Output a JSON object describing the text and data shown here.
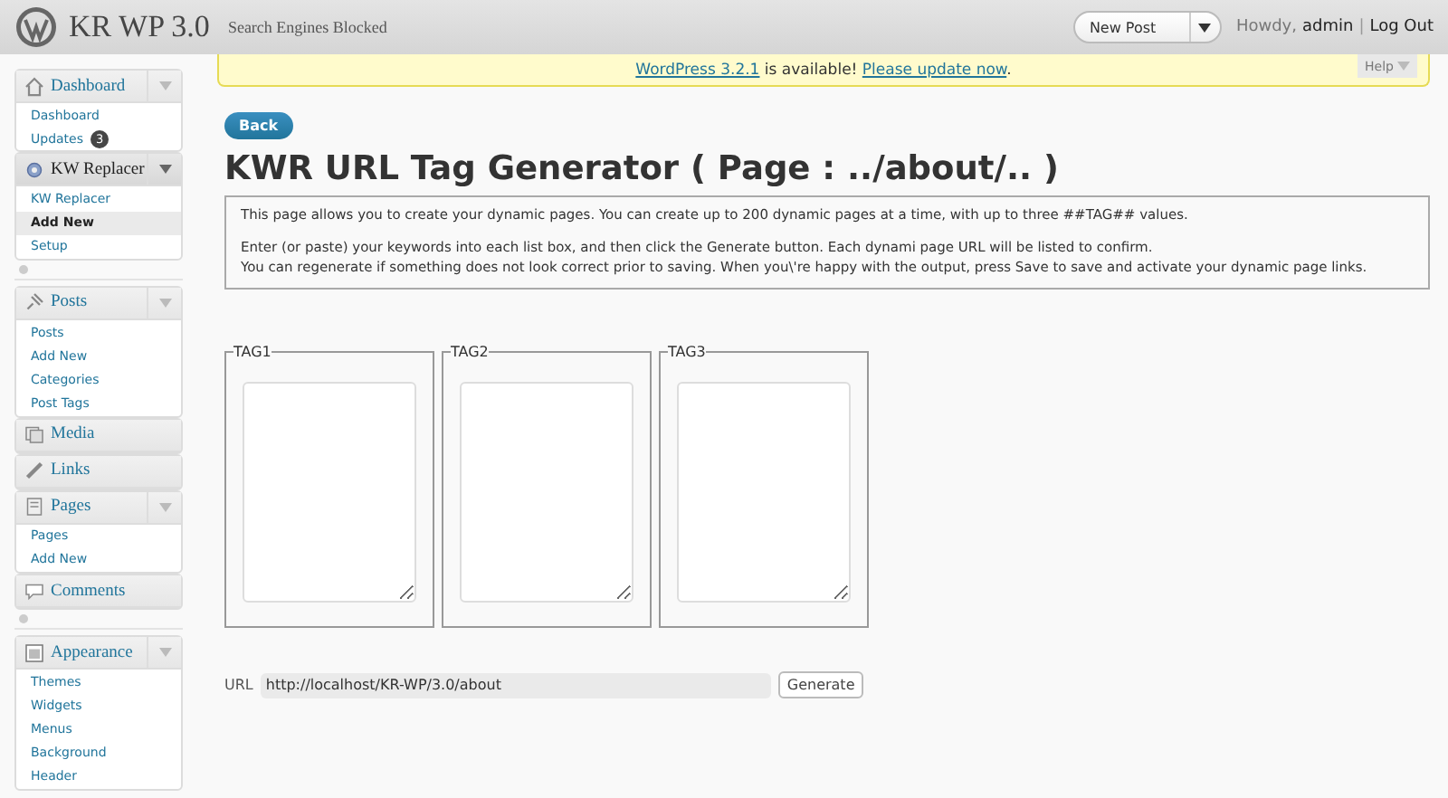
{
  "header": {
    "site_title": "KR WP 3.0",
    "site_note": "Search Engines Blocked",
    "new_post": "New Post",
    "howdy": "Howdy, ",
    "user": "admin",
    "separator": "|",
    "logout": "Log Out"
  },
  "notice": {
    "link1": "WordPress 3.2.1",
    "text": " is available! ",
    "link2": "Please update now",
    "end": ".",
    "help": "Help"
  },
  "menu": [
    {
      "kind": "group",
      "label": "Dashboard",
      "toggle": true,
      "current": false,
      "items": [
        {
          "label": "Dashboard",
          "selected": false
        },
        {
          "label": "Updates",
          "badge": "3",
          "selected": false
        }
      ]
    },
    {
      "kind": "group",
      "label": "KW Replacer",
      "toggle": true,
      "current": true,
      "items": [
        {
          "label": "KW Replacer",
          "selected": false
        },
        {
          "label": "Add New",
          "selected": true
        },
        {
          "label": "Setup",
          "selected": false
        }
      ]
    },
    {
      "kind": "separator"
    },
    {
      "kind": "group",
      "label": "Posts",
      "toggle": true,
      "current": false,
      "items": [
        {
          "label": "Posts",
          "selected": false
        },
        {
          "label": "Add New",
          "selected": false
        },
        {
          "label": "Categories",
          "selected": false
        },
        {
          "label": "Post Tags",
          "selected": false
        }
      ]
    },
    {
      "kind": "group",
      "label": "Media",
      "toggle": false,
      "current": false
    },
    {
      "kind": "group",
      "label": "Links",
      "toggle": false,
      "current": false
    },
    {
      "kind": "group",
      "label": "Pages",
      "toggle": true,
      "current": false,
      "items": [
        {
          "label": "Pages",
          "selected": false
        },
        {
          "label": "Add New",
          "selected": false
        }
      ]
    },
    {
      "kind": "group",
      "label": "Comments",
      "toggle": false,
      "current": false
    },
    {
      "kind": "separator"
    },
    {
      "kind": "group",
      "label": "Appearance",
      "toggle": true,
      "current": false,
      "items": [
        {
          "label": "Themes",
          "selected": false
        },
        {
          "label": "Widgets",
          "selected": false
        },
        {
          "label": "Menus",
          "selected": false
        },
        {
          "label": "Background",
          "selected": false
        },
        {
          "label": "Header",
          "selected": false
        }
      ]
    }
  ],
  "back": "Back",
  "title": "KWR URL Tag Generator ( Page : ../about/.. )",
  "description": [
    "This page allows you to create your dynamic pages. You can create up to 200 dynamic pages at a time, with up to three ##TAG## values.",
    "Enter (or paste) your keywords into each list box, and then click the Generate button. Each dynami page URL will be listed to confirm.\nYou can regenerate if something does not look correct prior to saving. When you\\'re happy with the output, press Save to save and activate your dynamic page links."
  ],
  "tags": [
    {
      "legend": "TAG1"
    },
    {
      "legend": "TAG2"
    },
    {
      "legend": "TAG3"
    }
  ],
  "url": {
    "label": "URL",
    "value": "http://localhost/KR-WP/3.0/about",
    "button": "Generate"
  }
}
